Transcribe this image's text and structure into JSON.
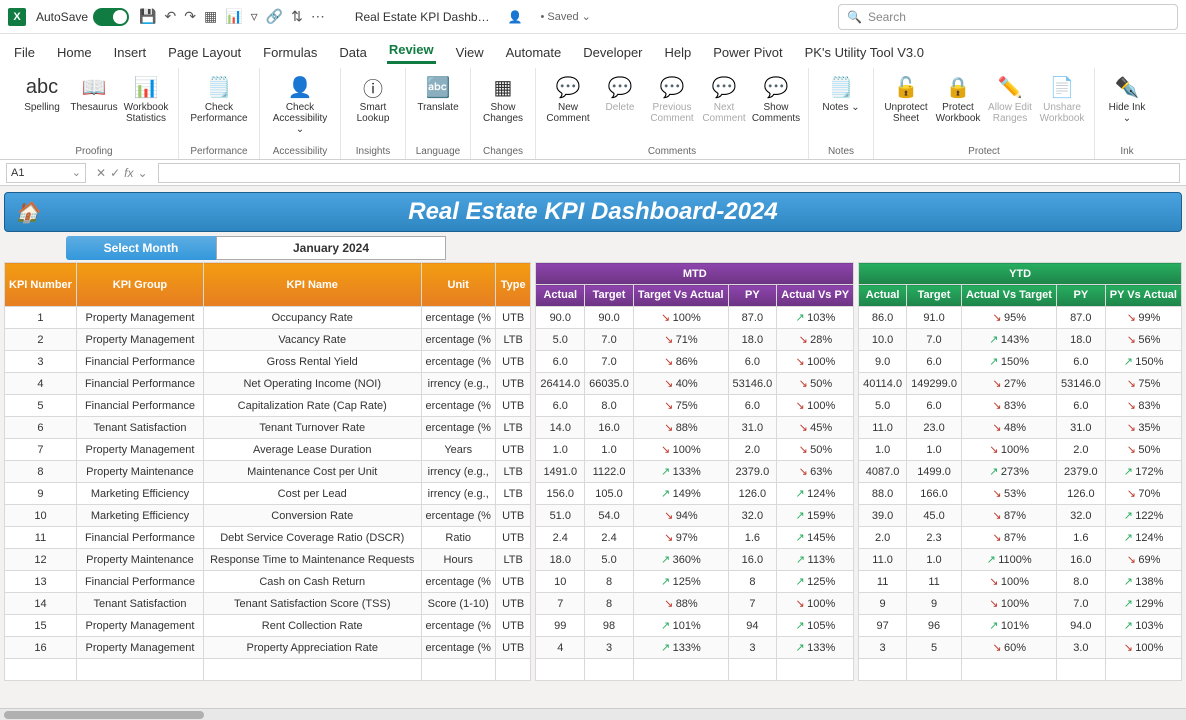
{
  "titlebar": {
    "autosave": "AutoSave",
    "docname": "Real Estate KPI Dashb…",
    "saved": "• Saved ⌄",
    "share": "👤",
    "search_ph": "Search"
  },
  "tabs": [
    "File",
    "Home",
    "Insert",
    "Page Layout",
    "Formulas",
    "Data",
    "Review",
    "View",
    "Automate",
    "Developer",
    "Help",
    "Power Pivot",
    "PK's Utility Tool V3.0"
  ],
  "active_tab": "Review",
  "ribbon": [
    {
      "label": "Proofing",
      "items": [
        {
          "icon": "abc",
          "lbl": "Spelling",
          "w": "narrow"
        },
        {
          "icon": "📖",
          "lbl": "Thesaurus",
          "w": "narrow"
        },
        {
          "icon": "📊",
          "lbl": "Workbook Statistics",
          "w": "narrow"
        }
      ]
    },
    {
      "label": "Performance",
      "items": [
        {
          "icon": "🗒️",
          "lbl": "Check Performance",
          "w": "wide"
        }
      ]
    },
    {
      "label": "Accessibility",
      "items": [
        {
          "icon": "👤",
          "lbl": "Check Accessibility ⌄",
          "w": "wide"
        }
      ]
    },
    {
      "label": "Insights",
      "items": [
        {
          "icon": "ⓘ",
          "lbl": "Smart Lookup",
          "w": "narrow"
        }
      ]
    },
    {
      "label": "Language",
      "items": [
        {
          "icon": "🔤",
          "lbl": "Translate",
          "w": "narrow"
        }
      ]
    },
    {
      "label": "Changes",
      "items": [
        {
          "icon": "▦",
          "lbl": "Show Changes",
          "w": "narrow"
        }
      ]
    },
    {
      "label": "Comments",
      "items": [
        {
          "icon": "💬",
          "lbl": "New Comment",
          "w": "narrow"
        },
        {
          "icon": "💬",
          "lbl": "Delete",
          "dim": true,
          "w": "narrow"
        },
        {
          "icon": "💬",
          "lbl": "Previous Comment",
          "dim": true,
          "w": "narrow"
        },
        {
          "icon": "💬",
          "lbl": "Next Comment",
          "dim": true,
          "w": "narrow"
        },
        {
          "icon": "💬",
          "lbl": "Show Comments",
          "w": "narrow"
        }
      ]
    },
    {
      "label": "Notes",
      "items": [
        {
          "icon": "🗒️",
          "lbl": "Notes ⌄",
          "w": "narrow"
        }
      ]
    },
    {
      "label": "Protect",
      "items": [
        {
          "icon": "🔓",
          "lbl": "Unprotect Sheet",
          "w": "narrow"
        },
        {
          "icon": "🔒",
          "lbl": "Protect Workbook",
          "w": "narrow"
        },
        {
          "icon": "✏️",
          "lbl": "Allow Edit Ranges",
          "dim": true,
          "w": "narrow"
        },
        {
          "icon": "📄",
          "lbl": "Unshare Workbook",
          "dim": true,
          "w": "narrow"
        }
      ]
    },
    {
      "label": "Ink",
      "items": [
        {
          "icon": "✒️",
          "lbl": "Hide Ink ⌄",
          "w": "narrow"
        }
      ]
    }
  ],
  "namebox": "A1",
  "dash": {
    "title": "Real Estate KPI Dashboard-2024",
    "select_label": "Select Month",
    "select_val": "January 2024",
    "mtd": "MTD",
    "ytd": "YTD"
  },
  "kpi_headers": [
    "KPI Number",
    "KPI Group",
    "KPI Name",
    "Unit",
    "Type"
  ],
  "mtd_headers": [
    "Actual",
    "Target",
    "Target Vs Actual",
    "PY",
    "Actual Vs PY"
  ],
  "ytd_headers": [
    "Actual",
    "Target",
    "Actual Vs Target",
    "PY",
    "PY Vs Actual"
  ],
  "rows": [
    {
      "n": "1",
      "g": "Property Management",
      "nm": "Occupancy Rate",
      "u": "ercentage (%",
      "t": "UTB",
      "ma": "90.0",
      "mt": "90.0",
      "mtvd": "r",
      "mtv": "100%",
      "mp": "87.0",
      "mpvd": "g",
      "mpv": "103%",
      "ya": "86.0",
      "yt": "91.0",
      "ytvd": "r",
      "ytv": "95%",
      "yp": "87.0",
      "ypvd": "r",
      "ypv": "99%"
    },
    {
      "n": "2",
      "g": "Property Management",
      "nm": "Vacancy Rate",
      "u": "ercentage (%",
      "t": "LTB",
      "ma": "5.0",
      "mt": "7.0",
      "mtvd": "r",
      "mtv": "71%",
      "mp": "18.0",
      "mpvd": "r",
      "mpv": "28%",
      "ya": "10.0",
      "yt": "7.0",
      "ytvd": "g",
      "ytv": "143%",
      "yp": "18.0",
      "ypvd": "r",
      "ypv": "56%"
    },
    {
      "n": "3",
      "g": "Financial Performance",
      "nm": "Gross Rental Yield",
      "u": "ercentage (%",
      "t": "UTB",
      "ma": "6.0",
      "mt": "7.0",
      "mtvd": "r",
      "mtv": "86%",
      "mp": "6.0",
      "mpvd": "r",
      "mpv": "100%",
      "ya": "9.0",
      "yt": "6.0",
      "ytvd": "g",
      "ytv": "150%",
      "yp": "6.0",
      "ypvd": "g",
      "ypv": "150%"
    },
    {
      "n": "4",
      "g": "Financial Performance",
      "nm": "Net Operating Income (NOI)",
      "u": "irrency (e.g.,",
      "t": "UTB",
      "ma": "26414.0",
      "mt": "66035.0",
      "mtvd": "r",
      "mtv": "40%",
      "mp": "53146.0",
      "mpvd": "r",
      "mpv": "50%",
      "ya": "40114.0",
      "yt": "149299.0",
      "ytvd": "r",
      "ytv": "27%",
      "yp": "53146.0",
      "ypvd": "r",
      "ypv": "75%"
    },
    {
      "n": "5",
      "g": "Financial Performance",
      "nm": "Capitalization Rate (Cap Rate)",
      "u": "ercentage (%",
      "t": "UTB",
      "ma": "6.0",
      "mt": "8.0",
      "mtvd": "r",
      "mtv": "75%",
      "mp": "6.0",
      "mpvd": "r",
      "mpv": "100%",
      "ya": "5.0",
      "yt": "6.0",
      "ytvd": "r",
      "ytv": "83%",
      "yp": "6.0",
      "ypvd": "r",
      "ypv": "83%"
    },
    {
      "n": "6",
      "g": "Tenant Satisfaction",
      "nm": "Tenant Turnover Rate",
      "u": "ercentage (%",
      "t": "LTB",
      "ma": "14.0",
      "mt": "16.0",
      "mtvd": "r",
      "mtv": "88%",
      "mp": "31.0",
      "mpvd": "r",
      "mpv": "45%",
      "ya": "11.0",
      "yt": "23.0",
      "ytvd": "r",
      "ytv": "48%",
      "yp": "31.0",
      "ypvd": "r",
      "ypv": "35%"
    },
    {
      "n": "7",
      "g": "Property Management",
      "nm": "Average Lease Duration",
      "u": "Years",
      "t": "UTB",
      "ma": "1.0",
      "mt": "1.0",
      "mtvd": "r",
      "mtv": "100%",
      "mp": "2.0",
      "mpvd": "r",
      "mpv": "50%",
      "ya": "1.0",
      "yt": "1.0",
      "ytvd": "r",
      "ytv": "100%",
      "yp": "2.0",
      "ypvd": "r",
      "ypv": "50%"
    },
    {
      "n": "8",
      "g": "Property Maintenance",
      "nm": "Maintenance Cost per Unit",
      "u": "irrency (e.g.,",
      "t": "LTB",
      "ma": "1491.0",
      "mt": "1122.0",
      "mtvd": "g",
      "mtv": "133%",
      "mp": "2379.0",
      "mpvd": "r",
      "mpv": "63%",
      "ya": "4087.0",
      "yt": "1499.0",
      "ytvd": "g",
      "ytv": "273%",
      "yp": "2379.0",
      "ypvd": "g",
      "ypv": "172%"
    },
    {
      "n": "9",
      "g": "Marketing Efficiency",
      "nm": "Cost per Lead",
      "u": "irrency (e.g.,",
      "t": "LTB",
      "ma": "156.0",
      "mt": "105.0",
      "mtvd": "g",
      "mtv": "149%",
      "mp": "126.0",
      "mpvd": "g",
      "mpv": "124%",
      "ya": "88.0",
      "yt": "166.0",
      "ytvd": "r",
      "ytv": "53%",
      "yp": "126.0",
      "ypvd": "r",
      "ypv": "70%"
    },
    {
      "n": "10",
      "g": "Marketing Efficiency",
      "nm": "Conversion Rate",
      "u": "ercentage (%",
      "t": "UTB",
      "ma": "51.0",
      "mt": "54.0",
      "mtvd": "r",
      "mtv": "94%",
      "mp": "32.0",
      "mpvd": "g",
      "mpv": "159%",
      "ya": "39.0",
      "yt": "45.0",
      "ytvd": "r",
      "ytv": "87%",
      "yp": "32.0",
      "ypvd": "g",
      "ypv": "122%"
    },
    {
      "n": "11",
      "g": "Financial Performance",
      "nm": "Debt Service Coverage Ratio (DSCR)",
      "u": "Ratio",
      "t": "UTB",
      "ma": "2.4",
      "mt": "2.4",
      "mtvd": "r",
      "mtv": "97%",
      "mp": "1.6",
      "mpvd": "g",
      "mpv": "145%",
      "ya": "2.0",
      "yt": "2.3",
      "ytvd": "r",
      "ytv": "87%",
      "yp": "1.6",
      "ypvd": "g",
      "ypv": "124%"
    },
    {
      "n": "12",
      "g": "Property Maintenance",
      "nm": "Response Time to Maintenance Requests",
      "u": "Hours",
      "t": "LTB",
      "ma": "18.0",
      "mt": "5.0",
      "mtvd": "g",
      "mtv": "360%",
      "mp": "16.0",
      "mpvd": "g",
      "mpv": "113%",
      "ya": "11.0",
      "yt": "1.0",
      "ytvd": "g",
      "ytv": "1100%",
      "yp": "16.0",
      "ypvd": "r",
      "ypv": "69%"
    },
    {
      "n": "13",
      "g": "Financial Performance",
      "nm": "Cash on Cash Return",
      "u": "ercentage (%",
      "t": "UTB",
      "ma": "10",
      "mt": "8",
      "mtvd": "g",
      "mtv": "125%",
      "mp": "8",
      "mpvd": "g",
      "mpv": "125%",
      "ya": "11",
      "yt": "11",
      "ytvd": "r",
      "ytv": "100%",
      "yp": "8.0",
      "ypvd": "g",
      "ypv": "138%"
    },
    {
      "n": "14",
      "g": "Tenant Satisfaction",
      "nm": "Tenant Satisfaction Score (TSS)",
      "u": "Score (1-10)",
      "t": "UTB",
      "ma": "7",
      "mt": "8",
      "mtvd": "r",
      "mtv": "88%",
      "mp": "7",
      "mpvd": "r",
      "mpv": "100%",
      "ya": "9",
      "yt": "9",
      "ytvd": "r",
      "ytv": "100%",
      "yp": "7.0",
      "ypvd": "g",
      "ypv": "129%"
    },
    {
      "n": "15",
      "g": "Property Management",
      "nm": "Rent Collection Rate",
      "u": "ercentage (%",
      "t": "UTB",
      "ma": "99",
      "mt": "98",
      "mtvd": "g",
      "mtv": "101%",
      "mp": "94",
      "mpvd": "g",
      "mpv": "105%",
      "ya": "97",
      "yt": "96",
      "ytvd": "g",
      "ytv": "101%",
      "yp": "94.0",
      "ypvd": "g",
      "ypv": "103%"
    },
    {
      "n": "16",
      "g": "Property Management",
      "nm": "Property Appreciation Rate",
      "u": "ercentage (%",
      "t": "UTB",
      "ma": "4",
      "mt": "3",
      "mtvd": "g",
      "mtv": "133%",
      "mp": "3",
      "mpvd": "g",
      "mpv": "133%",
      "ya": "3",
      "yt": "5",
      "ytvd": "r",
      "ytv": "60%",
      "yp": "3.0",
      "ypvd": "r",
      "ypv": "100%"
    }
  ]
}
